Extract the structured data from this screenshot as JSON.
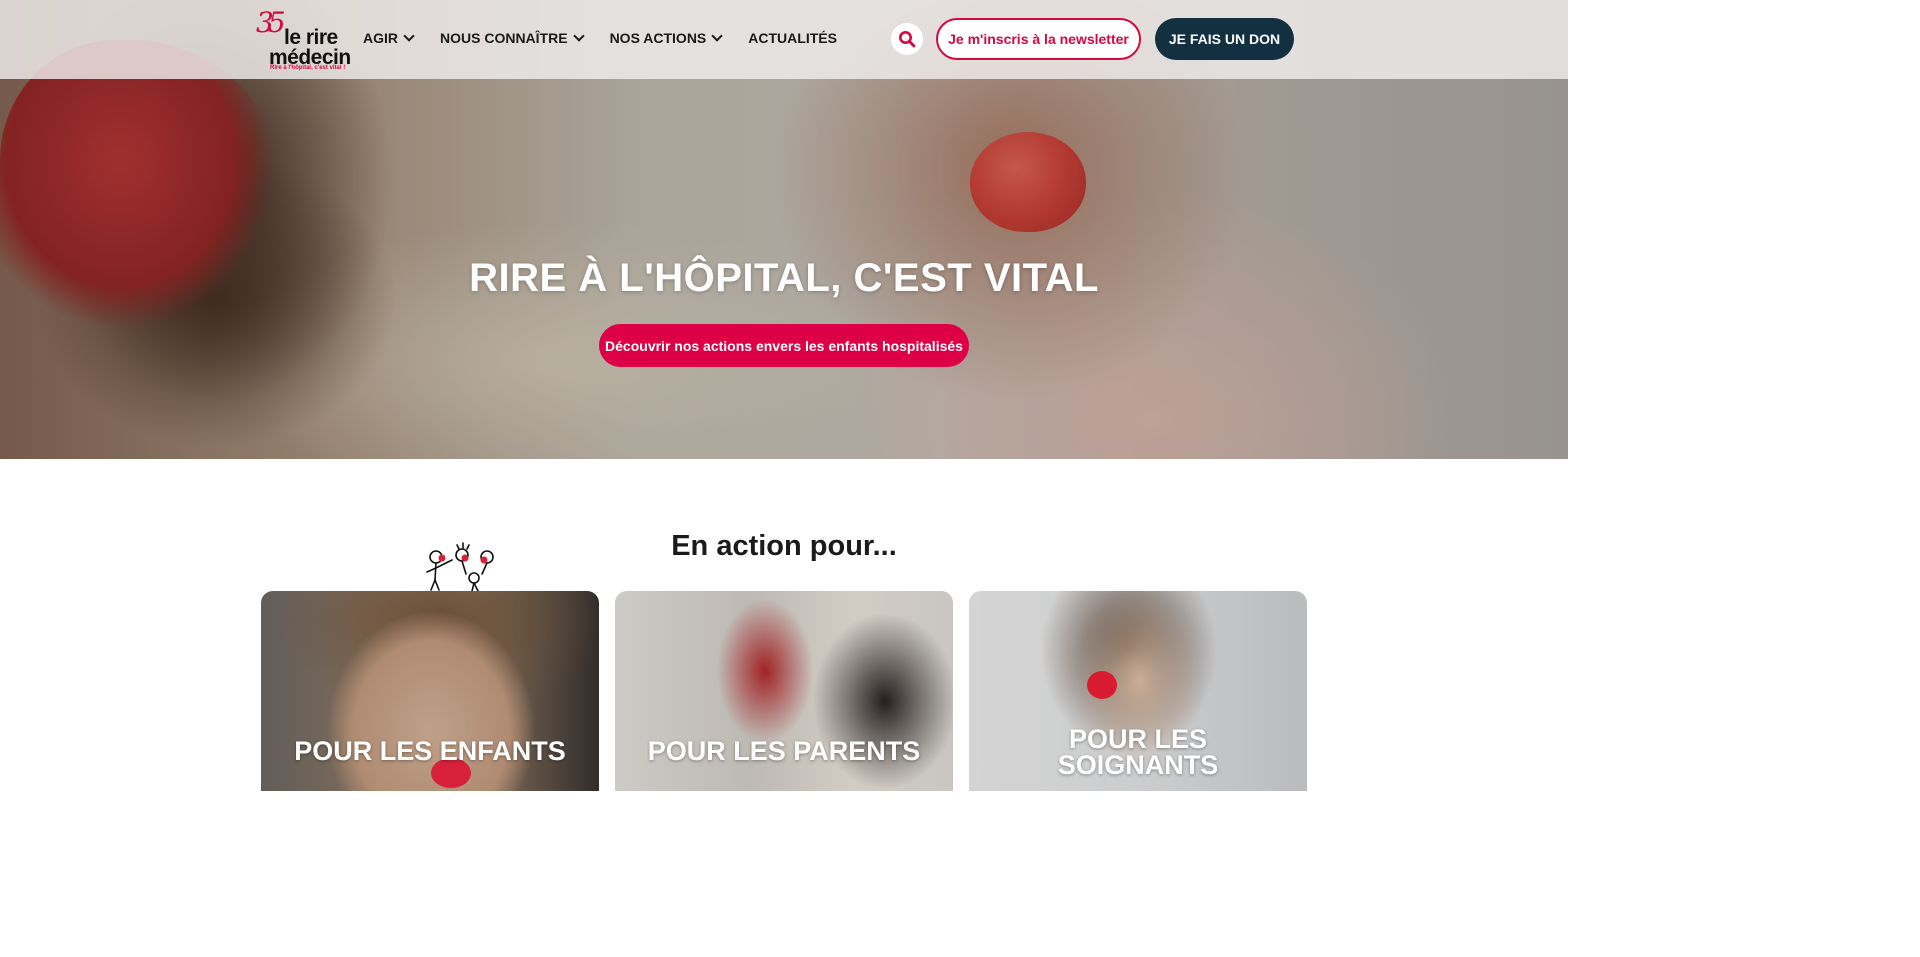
{
  "brand": {
    "logo_number": "35",
    "logo_line1": "le rire",
    "logo_line2": "médecin",
    "logo_tagline": "Rire à l'hôpital, c'est vital !",
    "accent_color": "#de0046",
    "dark_color": "#12303f"
  },
  "nav": {
    "items": [
      {
        "label": "AGIR",
        "has_dropdown": true
      },
      {
        "label": "NOUS CONNAÎTRE",
        "has_dropdown": true
      },
      {
        "label": "NOS ACTIONS",
        "has_dropdown": true
      },
      {
        "label": "ACTUALITÉS",
        "has_dropdown": false
      }
    ],
    "search_icon": "search-icon",
    "newsletter_label": "Je m'inscris à la newsletter",
    "donate_label": "JE FAIS UN DON"
  },
  "hero": {
    "title": "RIRE À L'HÔPITAL, C'EST VITAL",
    "cta_label": "Découvrir nos actions envers les enfants hospitalisés"
  },
  "section": {
    "title": "En action pour...",
    "cards": [
      {
        "label": "POUR LES ENFANTS"
      },
      {
        "label": "POUR LES PARENTS"
      },
      {
        "label_line1": "POUR LES",
        "label_line2": "SOIGNANTS"
      }
    ]
  }
}
